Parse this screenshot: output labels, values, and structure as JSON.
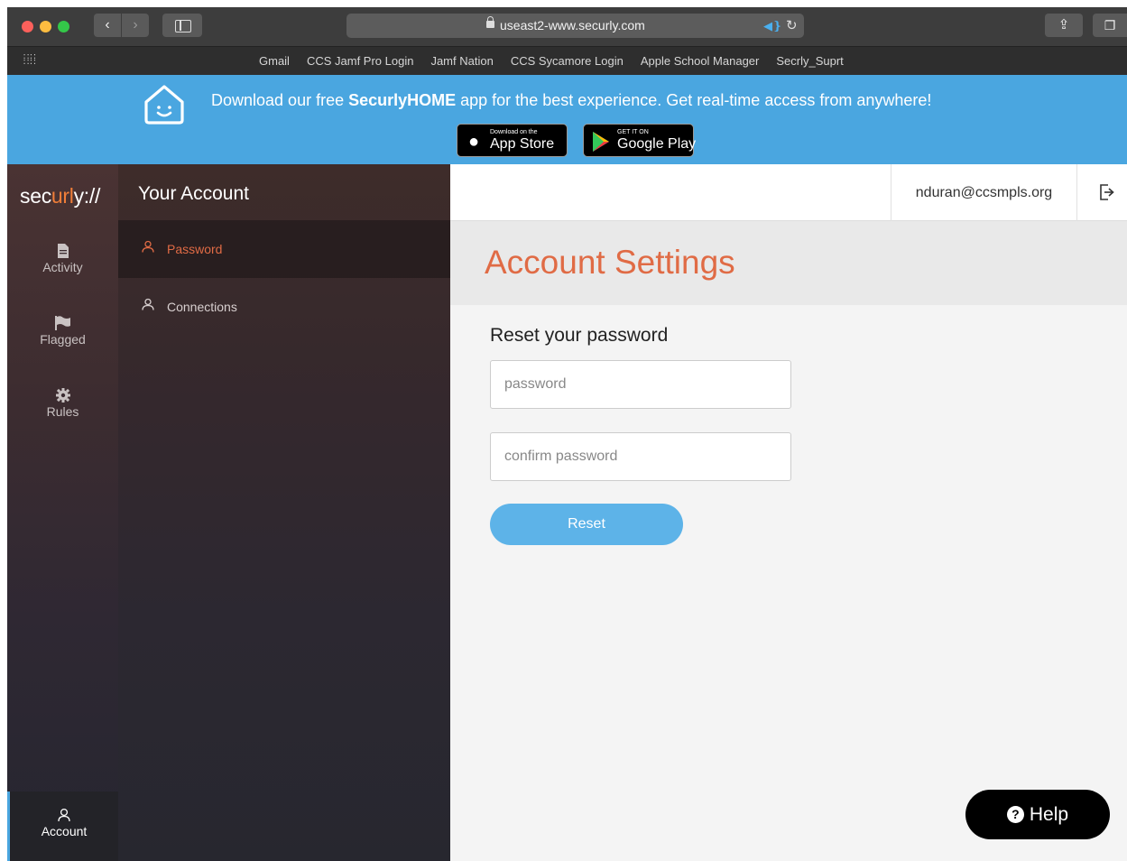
{
  "browser": {
    "url": "useast2-www.securly.com",
    "bookmarks": [
      "Gmail",
      "CCS Jamf Pro Login",
      "Jamf Nation",
      "CCS Sycamore Login",
      "Apple School Manager",
      "Secrly_Suprt"
    ]
  },
  "banner": {
    "text_prefix": "Download our free ",
    "text_brand": "SecurlyHOME",
    "text_suffix": " app for the best experience. Get real-time access from anywhere!",
    "appstore_small": "Download on the",
    "appstore_big": "App Store",
    "gplay_small": "GET IT ON",
    "gplay_big": "Google Play",
    "color": "#4aa6e0"
  },
  "rail": {
    "logo_prefix": "sec",
    "logo_accent": "url",
    "logo_suffix": "y://",
    "items": [
      {
        "label": "Activity",
        "icon": "document-icon"
      },
      {
        "label": "Flagged",
        "icon": "flag-icon"
      },
      {
        "label": "Rules",
        "icon": "gear-icon"
      }
    ],
    "account_label": "Account"
  },
  "subnav": {
    "title": "Your Account",
    "items": [
      {
        "label": "Password",
        "active": true
      },
      {
        "label": "Connections",
        "active": false
      }
    ]
  },
  "topbar": {
    "email": "nduran@ccsmpls.org"
  },
  "main": {
    "heading": "Account Settings",
    "section_title": "Reset your password",
    "password_placeholder": "password",
    "confirm_placeholder": "confirm password",
    "reset_label": "Reset"
  },
  "help": {
    "label": "Help"
  },
  "colors": {
    "accent": "#e06b45",
    "button": "#5db3e8",
    "logo_accent": "#f07e39"
  }
}
